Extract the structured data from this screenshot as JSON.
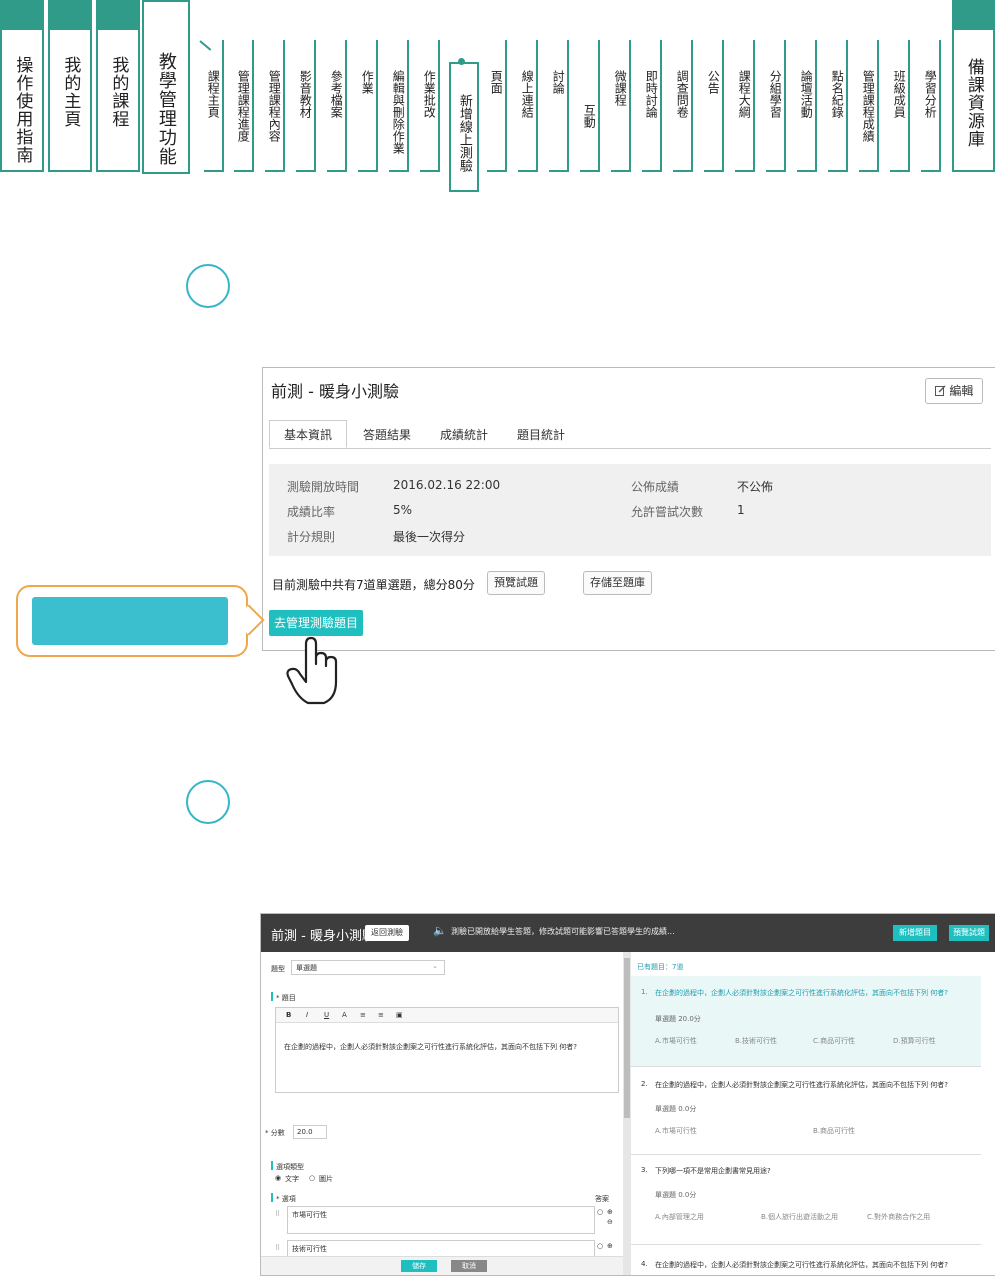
{
  "nav": {
    "main_tabs": [
      "操作使用指南",
      "我的主頁",
      "我的課程",
      "教學管理功能"
    ],
    "sub_tabs": [
      "課程主頁",
      "管理課程進度",
      "管理課程內容",
      "影音教材",
      "參考檔案",
      "作業",
      "編輯與刪除作業",
      "作業批改",
      "新增線上測驗",
      "頁面",
      "線上連結",
      "討論",
      "互動",
      "微課程",
      "即時討論",
      "調查問卷",
      "公告",
      "課程大綱",
      "分組學習",
      "論壇活動",
      "點名紀錄",
      "管理課程成績",
      "班級成員",
      "學習分析"
    ],
    "active_sub": "新增線上測驗",
    "right_tab": "備課資源庫",
    "accent_color": "#2f9b88"
  },
  "quiz_card": {
    "title": "前測 - 暖身小測驗",
    "edit_label": "編輯",
    "edit_icon": "edit-icon",
    "tabs": [
      "基本資訊",
      "答題結果",
      "成績統計",
      "題目統計"
    ],
    "info": {
      "open_time_label": "測驗開放時間",
      "open_time_value": "2016.02.16 22:00",
      "publish_label": "公佈成績",
      "publish_value": "不公佈",
      "ratio_label": "成績比率",
      "ratio_value": "5%",
      "attempts_label": "允許嘗試次數",
      "attempts_value": "1",
      "rule_label": "計分規則",
      "rule_value": "最後一次得分"
    },
    "summary": "目前測驗中共有7道單選題，總分80分",
    "preview_btn": "預覽試題",
    "save_bank_btn": "存儲至題庫",
    "manage_btn": "去管理測驗題目",
    "manage_btn_color": "#1fbfc0"
  },
  "callout_color": "#f0a64a",
  "editor": {
    "title": "前測 - 暖身小測驗",
    "back_btn": "返回測驗",
    "notice": "測驗已開放給學生答題，修改試題可能影響已答題學生的成績...",
    "new_btn": "新增題目",
    "preview_btn": "預覽試題",
    "type_label": "題型",
    "type_value": "單選題",
    "question_label": "* 題目",
    "toolbar": [
      "B",
      "I",
      "U",
      "A",
      "≡",
      "≡",
      "▣"
    ],
    "question_text": "在企劃的過程中，企劃人必須針對該企劃案之可行性進行系統化評估，其面向不包括下列 何者?",
    "score_label": "* 分數",
    "score_value": "20.0",
    "option_type_label": "選項類型",
    "option_type_text": "文字",
    "option_type_image": "圖片",
    "options_label": "* 選項",
    "answer_label": "答案",
    "option1": "市場可行性",
    "option2": "技術可行性",
    "save_btn": "儲存",
    "cancel_btn": "取消"
  },
  "question_list": {
    "header": "已有題目：7道",
    "items": [
      {
        "num": "1.",
        "text": "在企劃的過程中，企劃人必須針對該企劃案之可行性進行系統化評估，其面向不包括下列 何者?",
        "score": "單選題 20.0分",
        "opts": [
          "A.市場可行性",
          "B.技術可行性",
          "C.商品可行性",
          "D.預算可行性"
        ]
      },
      {
        "num": "2.",
        "text": "在企劃的過程中，企劃人必須針對該企劃案之可行性進行系統化評估，其面向不包括下列 何者?",
        "score": "單選題 0.0分",
        "opts": [
          "A.市場可行性",
          "B.商品可行性"
        ]
      },
      {
        "num": "3.",
        "text": "下列哪一項不是常用企劃書常見用途?",
        "score": "單選題 0.0分",
        "opts": [
          "A.內部管理之用",
          "B.個人旅行出遊活動之用",
          "C.對外商務合作之用"
        ]
      },
      {
        "num": "4.",
        "text": "在企劃的過程中，企劃人必須針對該企劃案之可行性進行系統化評估，其面向不包括下列 何者?"
      }
    ]
  }
}
